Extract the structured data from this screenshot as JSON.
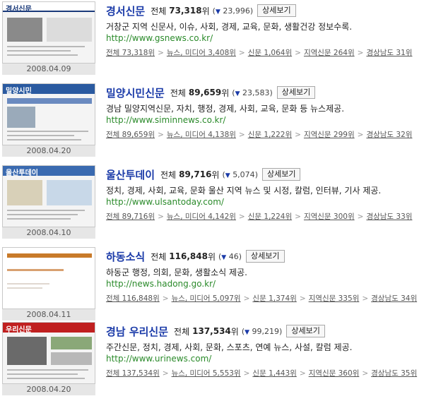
{
  "labels": {
    "rank_prefix": "전체",
    "rank_unit": "위",
    "detail_button": "상세보기",
    "change_arrow": "▼",
    "crumb_separator": ">"
  },
  "entries": [
    {
      "thumb_text": "경서신문",
      "title": "경서신문",
      "rank": "73,318",
      "change": "23,996",
      "description": "거창군 지역 신문사, 이슈, 사회, 경제, 교육, 문화, 생활건강 정보수록.",
      "url": "http://www.gsnews.co.kr/",
      "date": "2008.04.09",
      "crumbs": [
        "전체 73,318위",
        "뉴스, 미디어 3,408위",
        "신문 1,064위",
        "지역신문 264위",
        "경상남도 31위"
      ],
      "accent": "#1a3a7a"
    },
    {
      "thumb_text": "밀양시민",
      "title": "밀양시민신문",
      "rank": "89,659",
      "change": "23,583",
      "description": "경남 밀양지역신문, 자치, 행정, 경제, 사회, 교육, 문화 등 뉴스제공.",
      "url": "http://www.siminnews.co.kr/",
      "date": "2008.04.20",
      "crumbs": [
        "전체 89,659위",
        "뉴스, 미디어 4,138위",
        "신문 1,222위",
        "지역신문 299위",
        "경상남도 32위"
      ],
      "accent": "#2a5aa0"
    },
    {
      "thumb_text": "울산투데이",
      "title": "울산투데이",
      "rank": "89,716",
      "change": "5,074",
      "description": "정치, 경제, 사회, 교육, 문화 울산 지역 뉴스 및 시정, 칼럼, 인터뷰, 기사 제공.",
      "url": "http://www.ulsantoday.com/",
      "date": "2008.04.10",
      "crumbs": [
        "전체 89,716위",
        "뉴스, 미디어 4,142위",
        "신문 1,224위",
        "지역신문 300위",
        "경상남도 33위"
      ],
      "accent": "#3a6ab0"
    },
    {
      "thumb_text": "",
      "title": "하동소식",
      "rank": "116,848",
      "change": "46",
      "description": "하동군 행정, 의회, 문화, 생활소식 제공.",
      "url": "http://news.hadong.go.kr/",
      "date": "2008.04.11",
      "crumbs": [
        "전체 116,848위",
        "뉴스, 미디어 5,097위",
        "신문 1,374위",
        "지역신문 335위",
        "경상남도 34위"
      ],
      "accent": "#c87a2a"
    },
    {
      "thumb_text": "우리신문",
      "title": "경남 우리신문",
      "rank": "137,534",
      "change": "99,219",
      "description": "주간신문, 정치, 경제, 사회, 문화, 스포츠, 연예 뉴스, 사설, 칼럼 제공.",
      "url": "http://www.urinews.com/",
      "date": "2008.04.20",
      "crumbs": [
        "전체 137,534위",
        "뉴스, 미디어 5,553위",
        "신문 1,443위",
        "지역신문 360위",
        "경상남도 35위"
      ],
      "accent": "#c02020"
    }
  ]
}
